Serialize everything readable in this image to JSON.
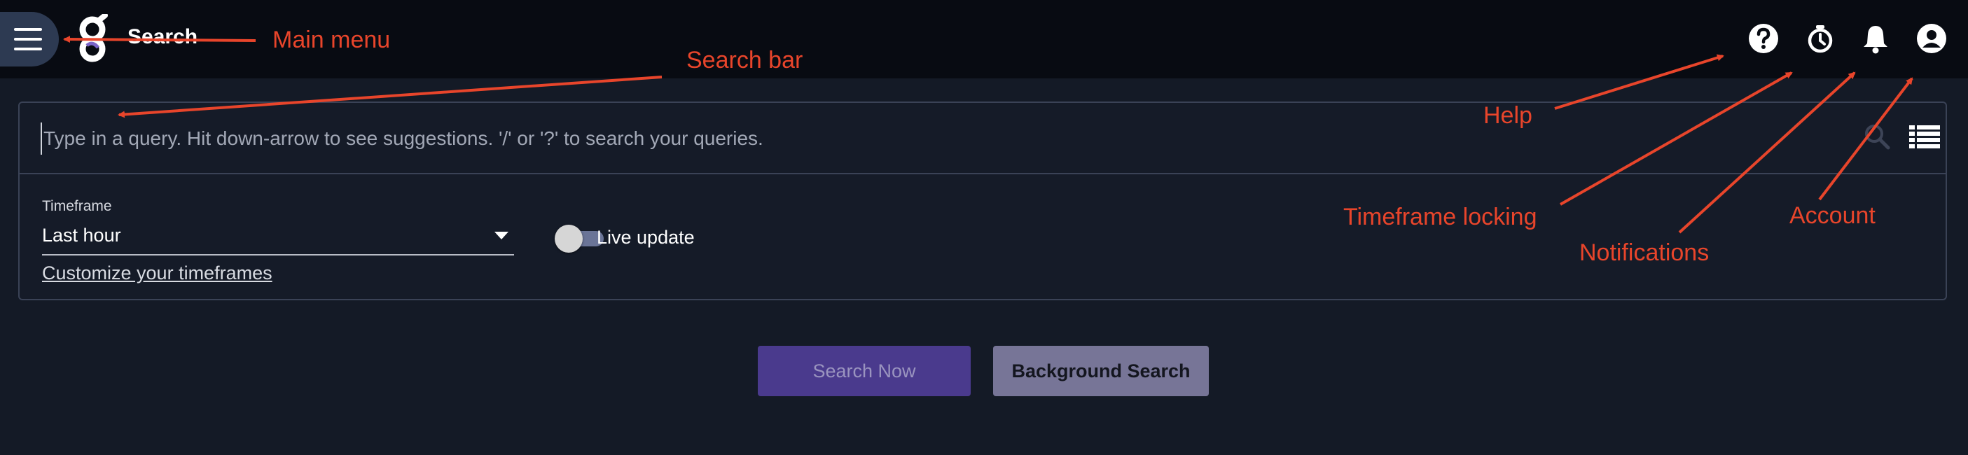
{
  "app": {
    "title": "Search"
  },
  "header_icons": [
    "menu-icon",
    "logo-icon",
    "help-icon",
    "timeframe-lock-icon",
    "notifications-icon",
    "account-icon"
  ],
  "search": {
    "placeholder": "Type in a query. Hit down-arrow to see suggestions. '/' or '?' to search your queries."
  },
  "timeframe": {
    "label": "Timeframe",
    "value": "Last hour",
    "customize_link": "Customize your timeframes"
  },
  "live_update": {
    "label": "Live update",
    "enabled": false
  },
  "buttons": {
    "search_now": "Search Now",
    "background_search": "Background Search"
  },
  "annotations": {
    "main_menu": "Main menu",
    "search_bar": "Search bar",
    "help": "Help",
    "timeframe_locking": "Timeframe locking",
    "notifications": "Notifications",
    "account": "Account"
  },
  "colors": {
    "background": "#141a26",
    "topbar": "#080b12",
    "accent_button": "#4a3a8d",
    "secondary_button": "#777597",
    "annotation": "#e8452b"
  }
}
